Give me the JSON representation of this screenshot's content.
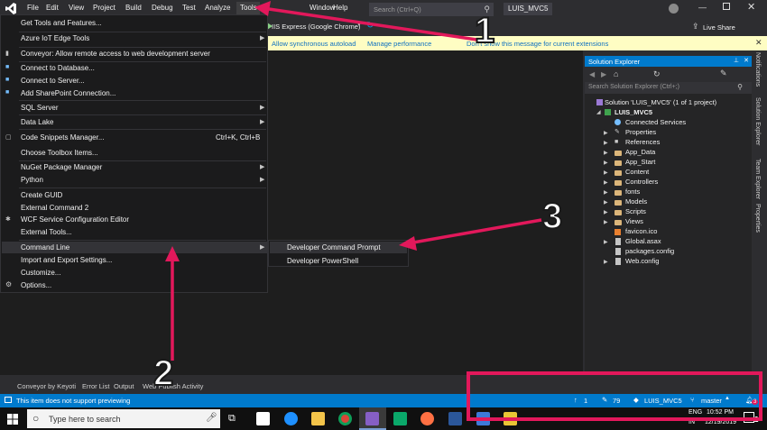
{
  "menubar": {
    "items": [
      "File",
      "Edit",
      "View",
      "Project",
      "Build",
      "Debug",
      "Test",
      "Analyze",
      "Tools",
      "Window",
      "Help"
    ],
    "search_placeholder": "Search (Ctrl+Q)",
    "project_name": "LUIS_MVC5",
    "live_share": "Live Share"
  },
  "toolbar": {
    "run_target": "IIS Express (Google Chrome)"
  },
  "infobar": {
    "allow_autoload": "Allow synchronous autoload",
    "manage_performance": "Manage performance",
    "dont_show": "Don't show this message for current extensions"
  },
  "tools_menu": {
    "items": [
      {
        "label": "Get Tools and Features..."
      },
      {
        "label": "Azure IoT Edge Tools"
      },
      {
        "label": "Conveyor: Allow remote access to web development server"
      },
      {
        "label": "Connect to Database..."
      },
      {
        "label": "Connect to Server..."
      },
      {
        "label": "Add SharePoint Connection..."
      },
      {
        "label": "SQL Server"
      },
      {
        "label": "Data Lake"
      },
      {
        "label": "Code Snippets Manager...",
        "shortcut": "Ctrl+K, Ctrl+B"
      },
      {
        "label": "Choose Toolbox Items..."
      },
      {
        "label": "NuGet Package Manager"
      },
      {
        "label": "Python"
      },
      {
        "label": "Create GUID"
      },
      {
        "label": "External Command 2"
      },
      {
        "label": "WCF Service Configuration Editor"
      },
      {
        "label": "External Tools..."
      },
      {
        "label": "Command Line"
      },
      {
        "label": "Import and Export Settings..."
      },
      {
        "label": "Customize..."
      },
      {
        "label": "Options..."
      }
    ]
  },
  "submenu": {
    "items": [
      "Developer Command Prompt",
      "Developer PowerShell"
    ]
  },
  "solution_explorer": {
    "title": "Solution Explorer",
    "search_placeholder": "Search Solution Explorer (Ctrl+;)",
    "solution_label": "Solution 'LUIS_MVC5' (1 of 1 project)",
    "project_label": "LUIS_MVC5",
    "nodes": [
      "Connected Services",
      "Properties",
      "References",
      "App_Data",
      "App_Start",
      "Content",
      "Controllers",
      "fonts",
      "Models",
      "Scripts",
      "Views",
      "favicon.ico",
      "Global.asax",
      "packages.config",
      "Web.config"
    ]
  },
  "right_tabs": [
    "Notifications",
    "Solution Explorer",
    "Team Explorer",
    "Properties"
  ],
  "bottom_tabs": [
    "Conveyor by Keyoti",
    "Error List",
    "Output",
    "Web Publish Activity"
  ],
  "statusbar": {
    "message": "This item does not support previewing",
    "up_count": "1",
    "pencil_count": "79",
    "repo": "LUIS_MVC5",
    "branch": "master",
    "bell_count": "3"
  },
  "taskbar": {
    "search_placeholder": "Type here to search",
    "language": "ENG",
    "region": "IN",
    "time": "10:52 PM",
    "date": "12/19/2019",
    "notif_count": "2"
  },
  "callouts": [
    "1",
    "2",
    "3"
  ],
  "colors": {
    "accent_blue": "#007acc",
    "annotation_pink": "#e2185b",
    "infobar_yellow": "#fefdc3",
    "menu_bg": "#1b1b1c"
  }
}
